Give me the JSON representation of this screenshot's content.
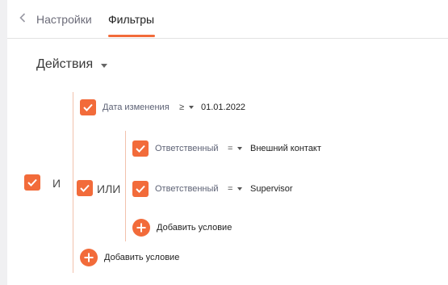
{
  "tabs": [
    {
      "label": "Настройки",
      "active": false
    },
    {
      "label": "Фильтры",
      "active": true
    }
  ],
  "actions": {
    "label": "Действия"
  },
  "filter": {
    "root_operator": "И",
    "conditions": [
      {
        "field": "Дата изменения",
        "operator": "≥",
        "value": "01.01.2022",
        "checked": true
      }
    ],
    "or_group": {
      "operator": "ИЛИ",
      "conditions": [
        {
          "field": "Ответственный",
          "operator": "=",
          "value": "Внешний контакт",
          "checked": true
        },
        {
          "field": "Ответственный",
          "operator": "=",
          "value": "Supervisor",
          "checked": true
        }
      ],
      "add_label": "Добавить условие"
    },
    "add_label": "Добавить условие"
  },
  "colors": {
    "accent": "#f26b3a",
    "bracket": "#f2c2ad",
    "divider": "#e2e2e2"
  }
}
